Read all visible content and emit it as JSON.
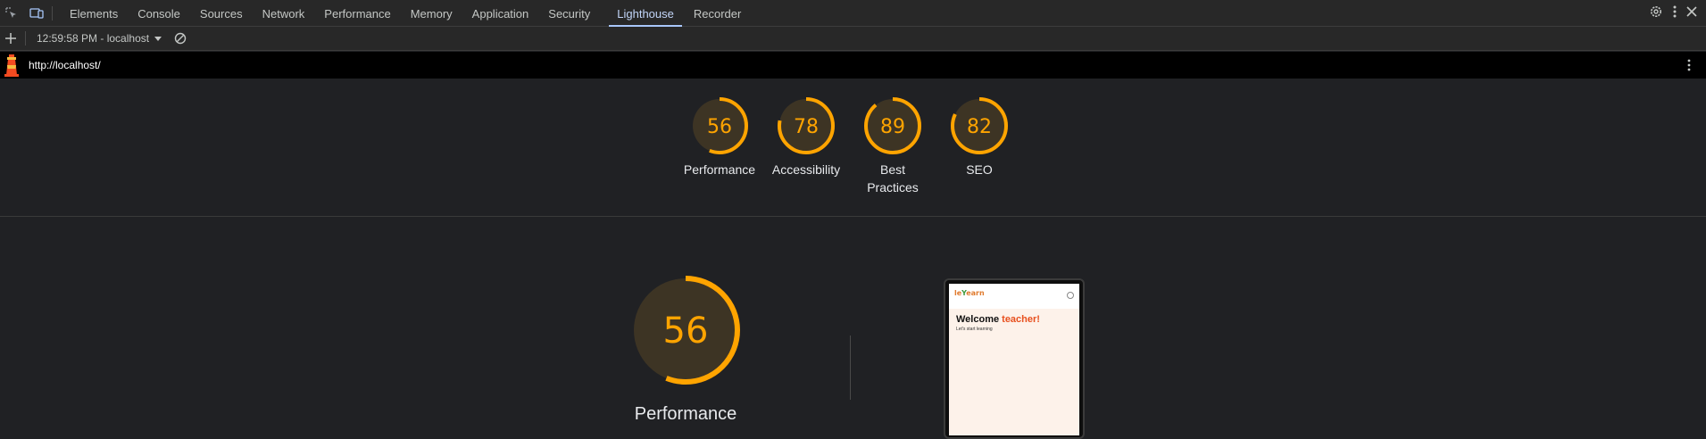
{
  "tabbar": {
    "tabs": [
      {
        "label": "Elements"
      },
      {
        "label": "Console"
      },
      {
        "label": "Sources"
      },
      {
        "label": "Network"
      },
      {
        "label": "Performance"
      },
      {
        "label": "Memory"
      },
      {
        "label": "Application"
      },
      {
        "label": "Security"
      },
      {
        "label": "Lighthouse",
        "active": true
      },
      {
        "label": "Recorder"
      }
    ]
  },
  "toolbar": {
    "report_label": "12:59:58 PM - localhost"
  },
  "urlbar": {
    "url": "http://localhost/"
  },
  "summary": {
    "categories": [
      {
        "score": "56",
        "label": "Performance",
        "fraction": 0.56
      },
      {
        "score": "78",
        "label": "Accessibility",
        "fraction": 0.78
      },
      {
        "score": "89",
        "label": "Best Practices",
        "fraction": 0.89
      },
      {
        "score": "82",
        "label": "SEO",
        "fraction": 0.82
      }
    ]
  },
  "main": {
    "score": "56",
    "fraction": 0.56,
    "title": "Performance",
    "screenshot": {
      "welcome": "Welcome",
      "welcome_accent": "teacher!",
      "subtitle": "Let's start learning"
    }
  },
  "colors": {
    "gauge_accent": "#ffa400",
    "gauge_bg": "#3d3424",
    "active_tab": "#a8c7fa"
  }
}
